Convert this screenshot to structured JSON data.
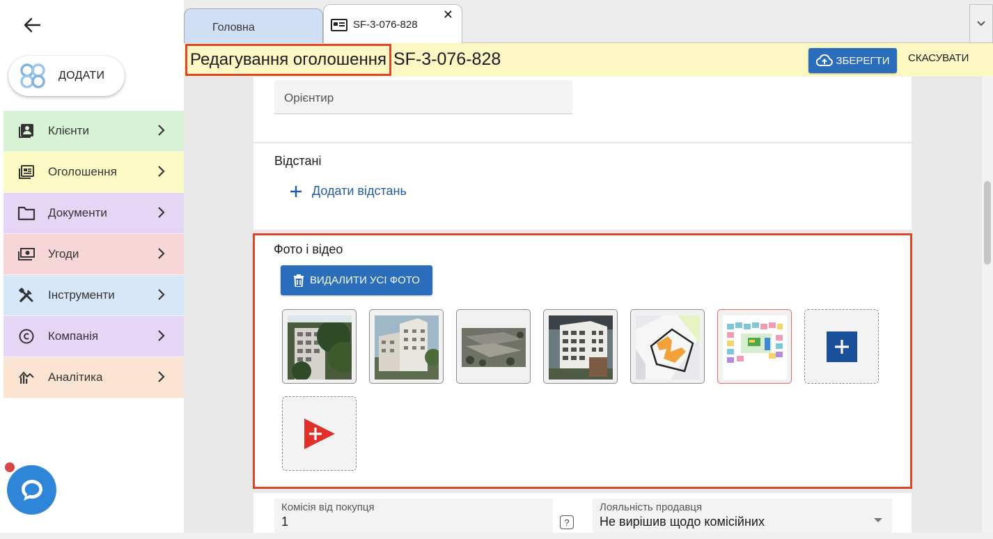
{
  "sidebar": {
    "add_label": "ДОДАТИ",
    "items": [
      {
        "label": "Клієнти",
        "icon": "contacts-icon",
        "bg": "#d8f2d5"
      },
      {
        "label": "Оголошення",
        "icon": "listing-icon",
        "bg": "#fcfbc6"
      },
      {
        "label": "Документи",
        "icon": "folder-icon",
        "bg": "#e6d6f6"
      },
      {
        "label": "Угоди",
        "icon": "money-icon",
        "bg": "#f6d6d6"
      },
      {
        "label": "Інструменти",
        "icon": "tools-icon",
        "bg": "#d5e7f9"
      },
      {
        "label": "Компанія",
        "icon": "copyright-icon",
        "bg": "#e6d6f6"
      },
      {
        "label": "Аналітика",
        "icon": "analytics-icon",
        "bg": "#fbe4d2"
      }
    ]
  },
  "tabs": {
    "home": "Головна",
    "edit": "SF-3-076-828"
  },
  "header": {
    "title": "Редагування оголошення",
    "code": "SF-3-076-828",
    "save_label": "ЗБЕРЕГТИ",
    "cancel_label": "СКАСУВАТИ"
  },
  "form": {
    "landmark_placeholder": "Орієнтир",
    "distances_title": "Відстані",
    "add_distance_label": "Додати відстань",
    "media_title": "Фото і відео",
    "delete_all_label": "ВИДАЛИТИ УСІ ФОТО",
    "commission_label": "Комісія від покупця",
    "commission_value": "1",
    "help_label": "?",
    "loyalty_label": "Лояльність продавця",
    "loyalty_value": "Не вирішив щодо комісійних"
  },
  "colors": {
    "accent": "#2a6dbb",
    "highlight": "#e0442c",
    "title_bg": "#fdf8c3",
    "link": "#1f5c9e",
    "chat": "#2f86d8"
  }
}
